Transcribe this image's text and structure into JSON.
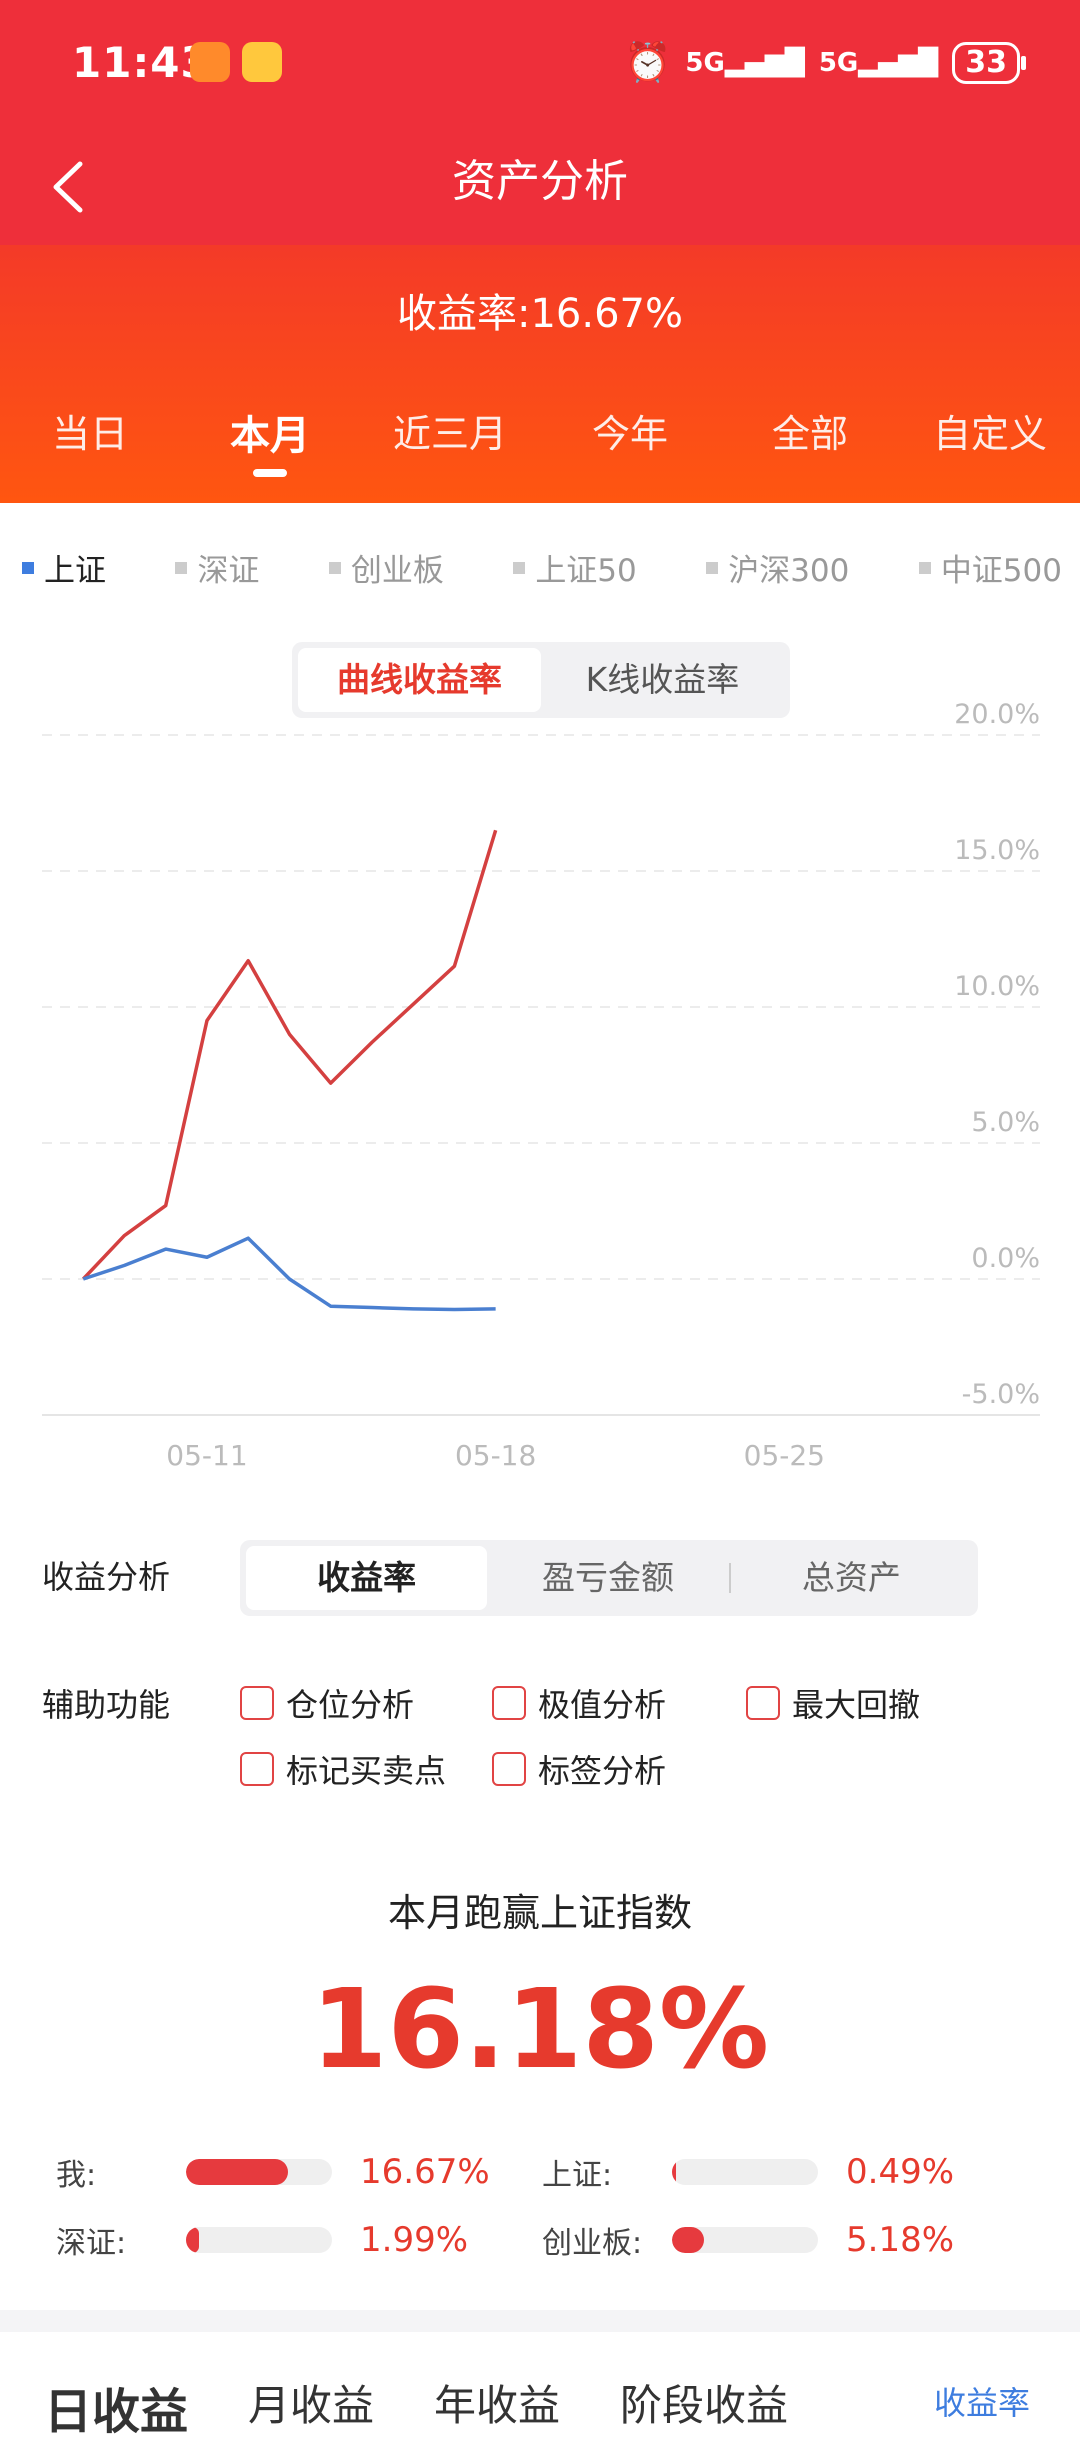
{
  "status": {
    "time": "11:43",
    "battery": "33",
    "signal1": "5G",
    "signal2": "5G"
  },
  "header": {
    "title": "资产分析"
  },
  "summary": {
    "rate_text": "收益率:16.67%"
  },
  "periods": [
    "当日",
    "本月",
    "近三月",
    "今年",
    "全部",
    "自定义"
  ],
  "active_period": "本月",
  "indexes": [
    "上证",
    "深证",
    "创业板",
    "上证50",
    "沪深300",
    "中证500"
  ],
  "active_index": "上证",
  "chart_toggle": {
    "curve": "曲线收益率",
    "kline": "K线收益率"
  },
  "chart_data": {
    "type": "line",
    "y_tick_labels": [
      "20.0%",
      "15.0%",
      "10.0%",
      "5.0%",
      "0.0%",
      "-5.0%"
    ],
    "x_tick_labels": [
      "05-11",
      "05-18",
      "05-25"
    ],
    "ylim": [
      -5,
      20
    ],
    "y_unit": "%",
    "x": [
      0,
      1,
      2,
      3,
      4,
      5,
      6,
      7,
      8,
      9,
      10,
      11
    ],
    "x_tick_positions": [
      3,
      10,
      17
    ],
    "x_range": [
      -1,
      23.2
    ],
    "series": [
      {
        "values": [
          0.0,
          1.6,
          2.7,
          9.5,
          11.7,
          9.0,
          7.2,
          8.7,
          10.1,
          11.5,
          16.5
        ],
        "color": "#d44040"
      },
      {
        "values": [
          0.0,
          0.5,
          1.1,
          0.8,
          1.5,
          0.0,
          -1.0,
          -1.05,
          -1.1,
          -1.12,
          -1.1
        ],
        "color": "#4a7fd0"
      }
    ]
  },
  "analysis": {
    "label": "收益分析",
    "tabs": [
      "收益率",
      "盈亏金额",
      "总资产"
    ],
    "active": "收益率"
  },
  "aux": {
    "label": "辅助功能",
    "options": [
      "仓位分析",
      "极值分析",
      "最大回撤",
      "标记买卖点",
      "标签分析"
    ]
  },
  "beat": {
    "title": "本月跑赢上证指数",
    "value": "16.18%"
  },
  "compare": [
    {
      "name": "我:",
      "value": "16.67%",
      "fraction": 0.7
    },
    {
      "name": "上证:",
      "value": "0.49%",
      "fraction": 0.03
    },
    {
      "name": "深证:",
      "value": "1.99%",
      "fraction": 0.09
    },
    {
      "name": "创业板:",
      "value": "5.18%",
      "fraction": 0.22
    }
  ],
  "bottom_tabs": [
    "日收益",
    "月收益",
    "年收益",
    "阶段收益"
  ],
  "bottom_more": "收益率",
  "colors": {
    "red": "#ee2f3a",
    "orange": "#ff5610",
    "accent": "#e63a2d",
    "blue": "#3e7ddf"
  }
}
